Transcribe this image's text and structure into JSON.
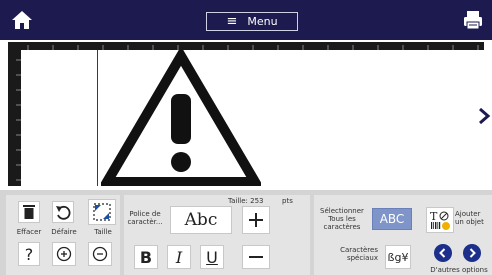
{
  "header": {
    "menu_label": "Menu"
  },
  "toolbar": {
    "delete_label": "Effacer",
    "undo_label": "Défaire",
    "size_label": "Taille",
    "font_label": "Police de caractèr...",
    "font_sample": "Abc",
    "size_value": "Taille: 253",
    "size_unit": "pts",
    "bold_label": "B",
    "italic_label": "I",
    "underline_label": "U",
    "select_all_label": "Sélectionner Tous les caractères",
    "select_all_sample": "ABC",
    "special_chars_label": "Caractères spéciaux",
    "add_object_label": "Ajouter un objet",
    "more_options_label": "D'autres options"
  }
}
